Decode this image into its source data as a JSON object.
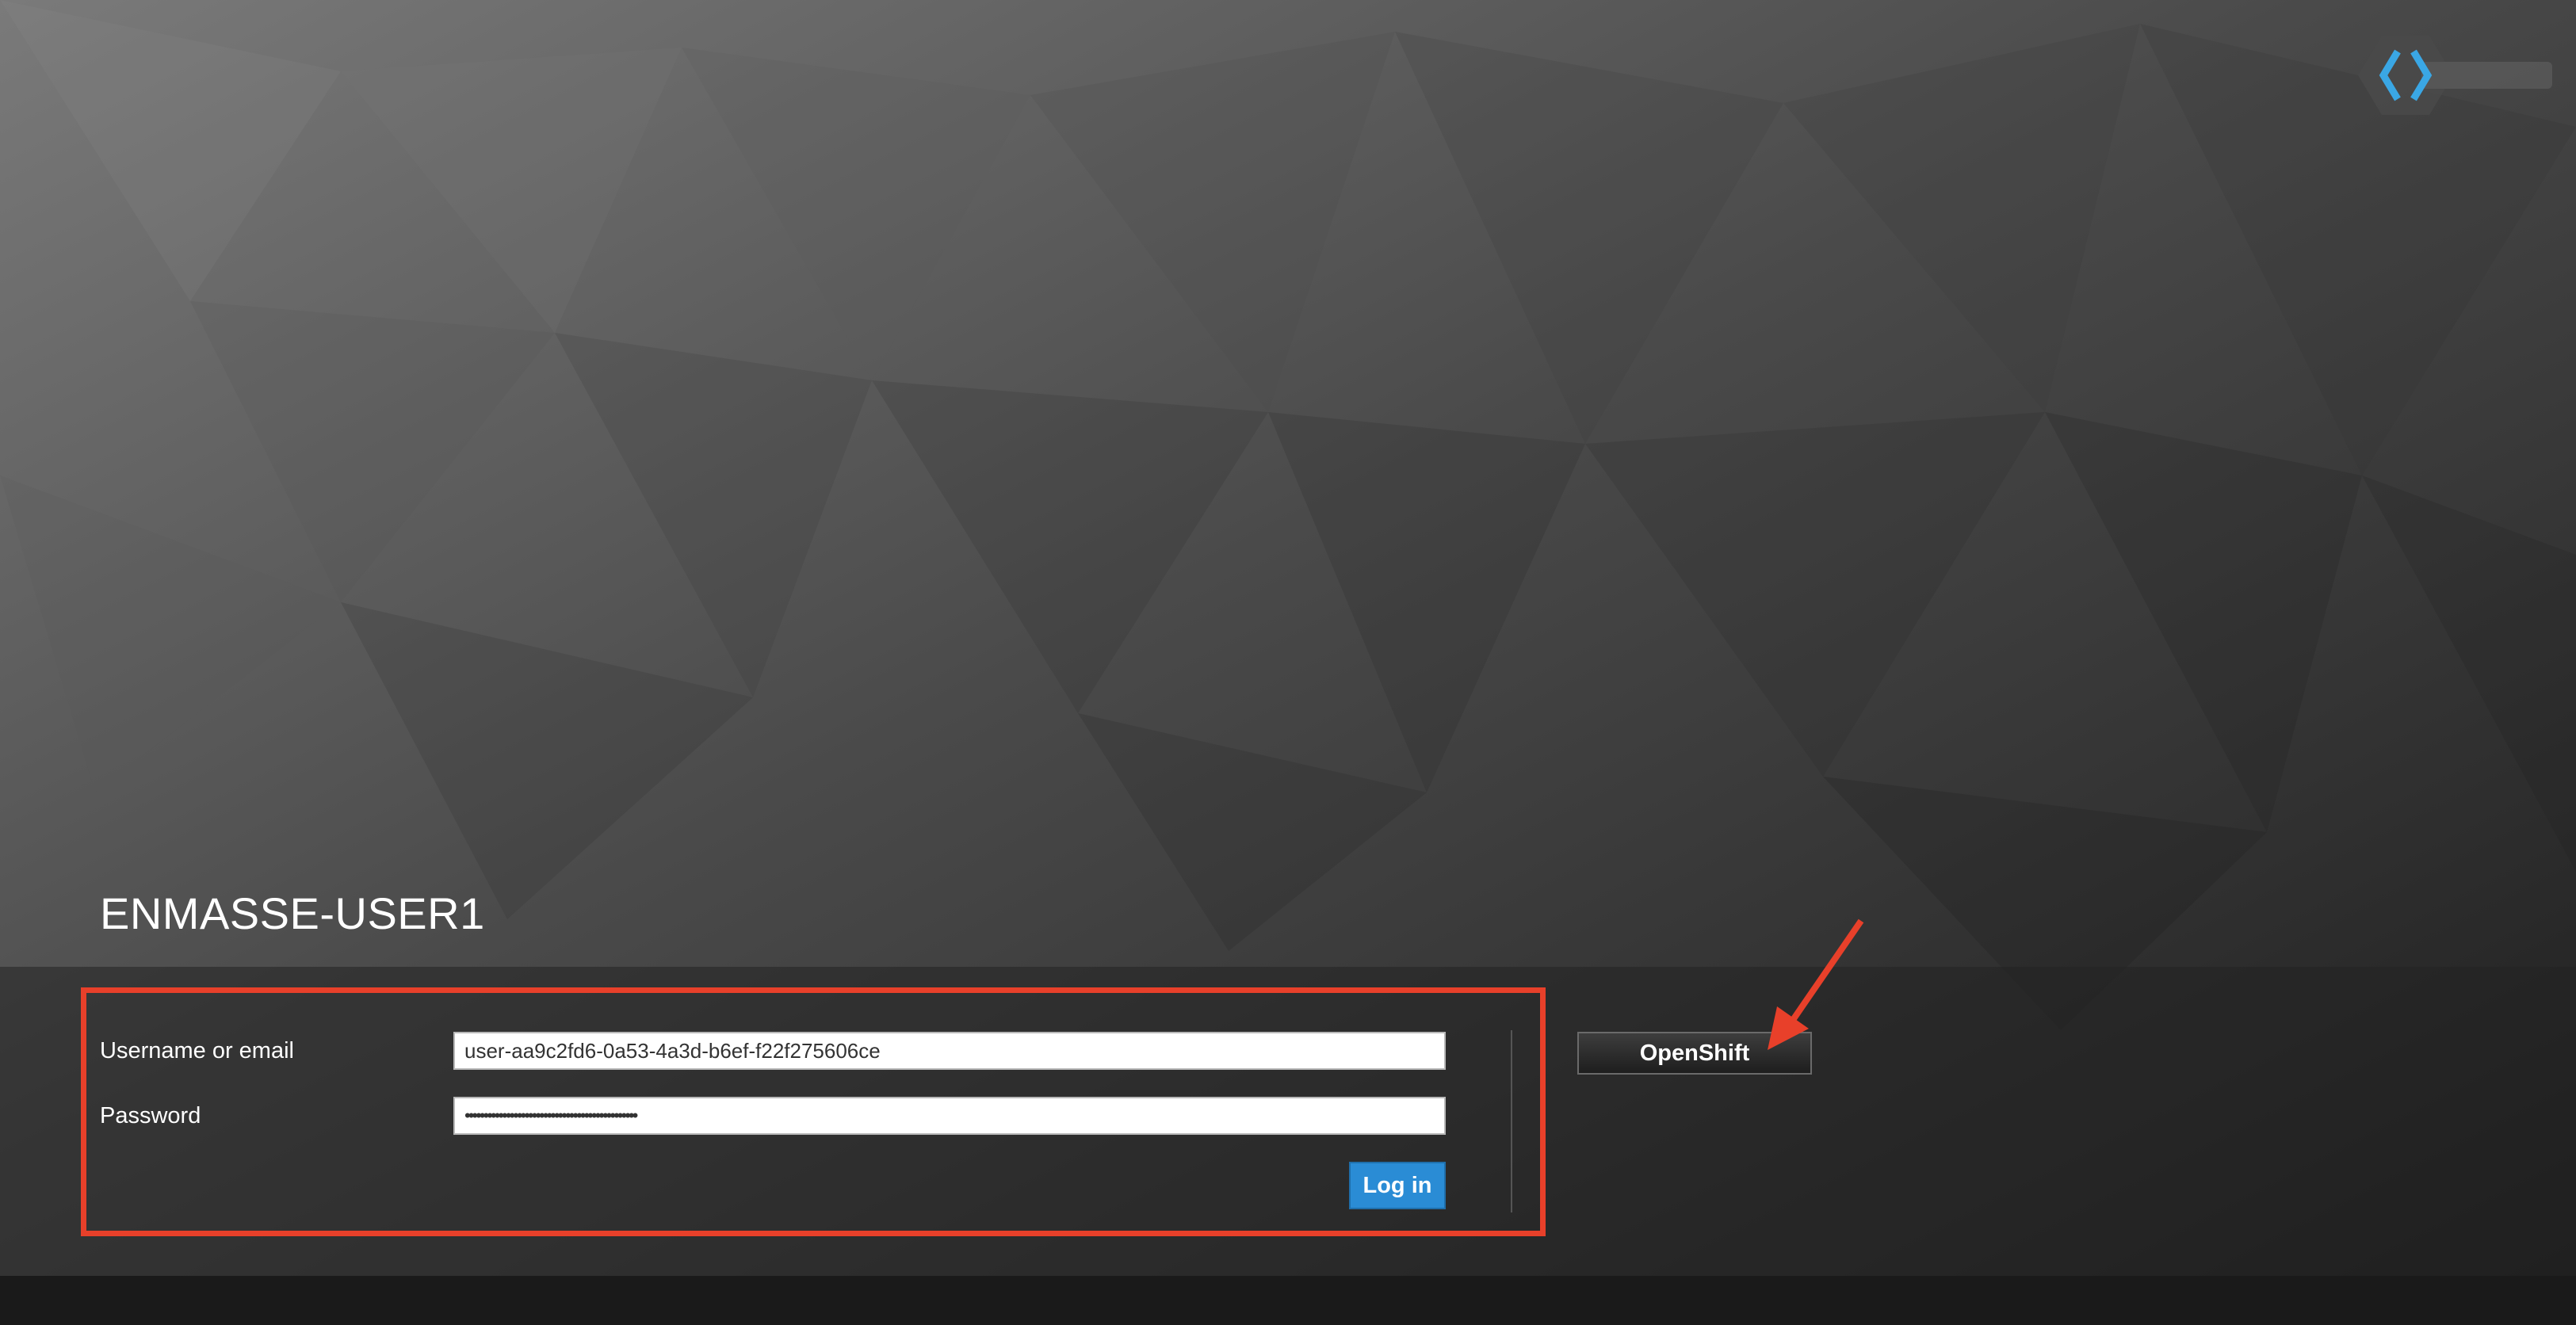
{
  "realm": {
    "title": "ENMASSE-USER1"
  },
  "login_form": {
    "username_label": "Username or email",
    "username_value": "user-aa9c2fd6-0a53-4a3d-b6ef-f22f275606ce",
    "password_label": "Password",
    "password_value": "••••••••••••••••••••••••••••••••••••••••••••••",
    "submit_label": "Log in"
  },
  "identity_providers": [
    {
      "label": "OpenShift"
    }
  ],
  "annotations": {
    "highlight_color": "#e8402a",
    "arrow_color": "#e8402a"
  },
  "colors": {
    "primary_button": "#2a8cd5",
    "logo_accent": "#3aa7e5"
  },
  "logo": {
    "icon": "keycloak-logo-icon"
  }
}
